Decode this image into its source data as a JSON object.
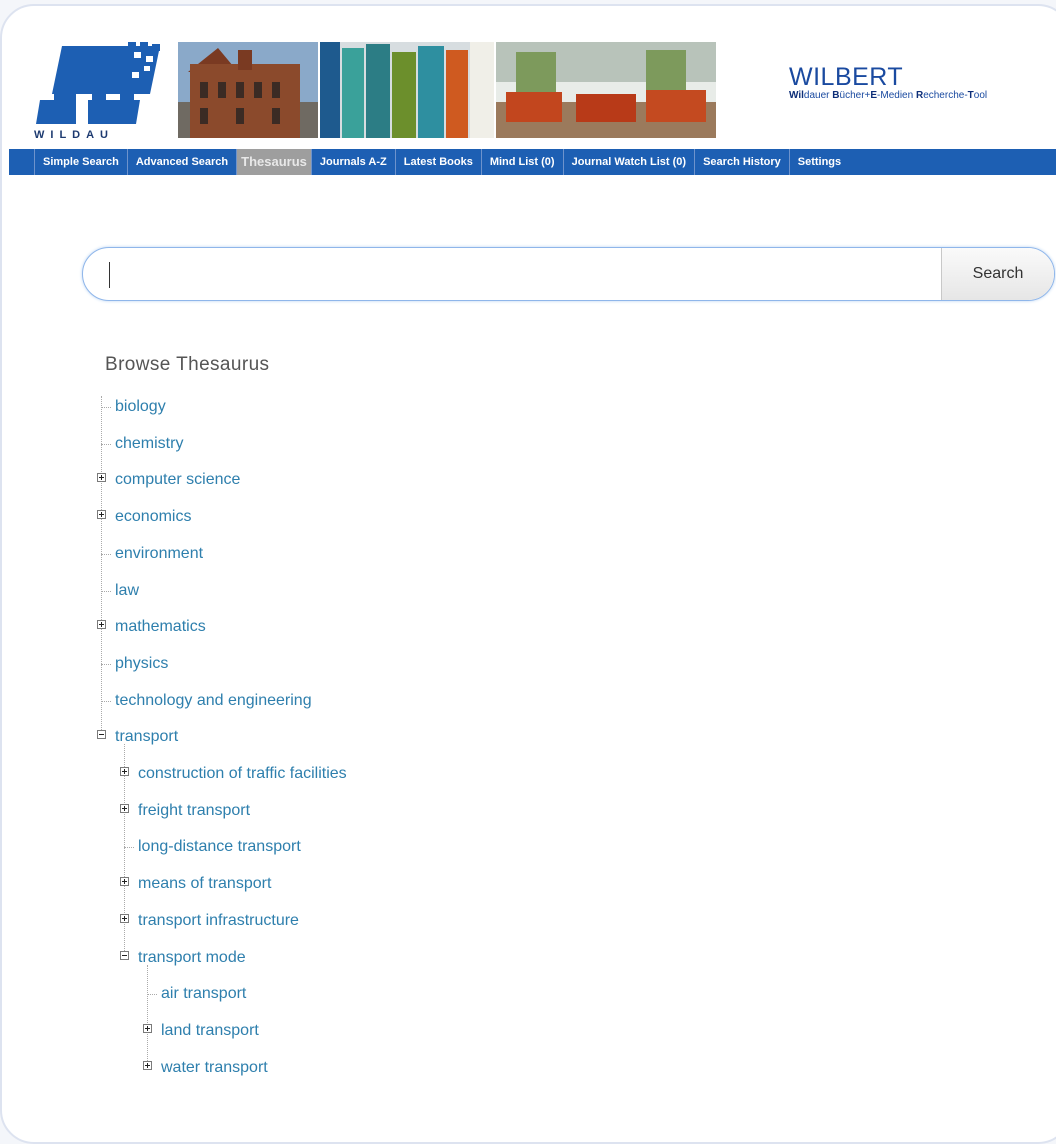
{
  "brand": {
    "title": "WILBERT",
    "sub_parts": [
      "Wil",
      "dauer ",
      "B",
      "ücher+",
      "E",
      "-Medien ",
      "R",
      "echerche-",
      "T",
      "ool"
    ]
  },
  "logo": {
    "text": "WILDAU",
    "name": "th-wildau-logo"
  },
  "nav": [
    {
      "label": "Simple Search",
      "active": false
    },
    {
      "label": "Advanced Search",
      "active": false
    },
    {
      "label": "Thesaurus",
      "active": true
    },
    {
      "label": "Journals A-Z",
      "active": false
    },
    {
      "label": "Latest Books",
      "active": false
    },
    {
      "label": "Mind List (0)",
      "active": false
    },
    {
      "label": "Journal Watch List (0)",
      "active": false
    },
    {
      "label": "Search History",
      "active": false
    },
    {
      "label": "Settings",
      "active": false
    }
  ],
  "search": {
    "value": "",
    "button_label": "Search"
  },
  "browse": {
    "title": "Browse Thesaurus"
  },
  "tree": [
    {
      "label": "biology",
      "level": 0,
      "state": "leaf"
    },
    {
      "label": "chemistry",
      "level": 0,
      "state": "leaf"
    },
    {
      "label": "computer science",
      "level": 0,
      "state": "collapsed"
    },
    {
      "label": "economics",
      "level": 0,
      "state": "collapsed"
    },
    {
      "label": "environment",
      "level": 0,
      "state": "leaf"
    },
    {
      "label": "law",
      "level": 0,
      "state": "leaf"
    },
    {
      "label": "mathematics",
      "level": 0,
      "state": "collapsed"
    },
    {
      "label": "physics",
      "level": 0,
      "state": "leaf"
    },
    {
      "label": "technology and engineering",
      "level": 0,
      "state": "leaf"
    },
    {
      "label": "transport",
      "level": 0,
      "state": "expanded"
    },
    {
      "label": "construction of traffic facilities",
      "level": 1,
      "state": "collapsed"
    },
    {
      "label": "freight transport",
      "level": 1,
      "state": "collapsed"
    },
    {
      "label": "long-distance transport",
      "level": 1,
      "state": "leaf"
    },
    {
      "label": "means of transport",
      "level": 1,
      "state": "collapsed"
    },
    {
      "label": "transport infrastructure",
      "level": 1,
      "state": "collapsed"
    },
    {
      "label": "transport mode",
      "level": 1,
      "state": "expanded"
    },
    {
      "label": "air transport",
      "level": 2,
      "state": "leaf"
    },
    {
      "label": "land transport",
      "level": 2,
      "state": "collapsed"
    },
    {
      "label": "water transport",
      "level": 2,
      "state": "collapsed"
    }
  ],
  "colors": {
    "nav_bg": "#1d5fb3",
    "nav_active": "#9e9e9e",
    "link": "#2e7fad",
    "brand": "#1a4aa0"
  }
}
